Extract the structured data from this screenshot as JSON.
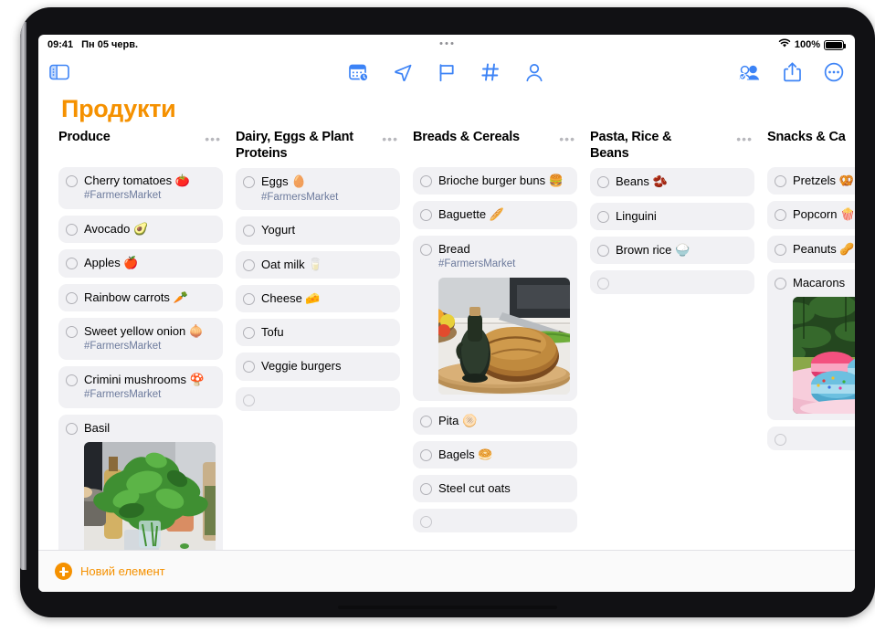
{
  "statusbar": {
    "time": "09:41",
    "date": "Пн 05 черв.",
    "battery_percent": "100%",
    "wifi_icon": "wifi-icon",
    "battery_icon": "battery-icon"
  },
  "toolbar": {
    "sidebar_toggle_icon": "sidebar-toggle-icon",
    "center_icons": [
      {
        "name": "calendar-clock-icon"
      },
      {
        "name": "send-arrow-icon"
      },
      {
        "name": "flag-icon"
      },
      {
        "name": "hashtag-icon"
      },
      {
        "name": "person-icon"
      }
    ],
    "right_icons": [
      {
        "name": "collaborate-icon"
      },
      {
        "name": "share-icon"
      },
      {
        "name": "more-circle-icon"
      }
    ],
    "accent_color": "#3C83F6"
  },
  "page_title": "Продукти",
  "title_color": "#F59100",
  "columns": [
    {
      "title": "Produce",
      "menu": "•••",
      "items": [
        {
          "text": "Cherry tomatoes 🍅",
          "tag": "#FarmersMarket"
        },
        {
          "text": "Avocado 🥑",
          "tag": ""
        },
        {
          "text": "Apples 🍎",
          "tag": ""
        },
        {
          "text": "Rainbow carrots 🥕",
          "tag": ""
        },
        {
          "text": "Sweet yellow onion 🧅",
          "tag": "#FarmersMarket"
        },
        {
          "text": "Crimini mushrooms 🍄",
          "tag": "#FarmersMarket"
        },
        {
          "text": "Basil",
          "tag": "",
          "photo": "basil-plant-photo"
        },
        {
          "text": "",
          "tag": "",
          "empty": true
        }
      ]
    },
    {
      "title": "Dairy, Eggs & Plant\nProteins",
      "menu": "•••",
      "items": [
        {
          "text": "Eggs 🥚",
          "tag": "#FarmersMarket"
        },
        {
          "text": "Yogurt",
          "tag": ""
        },
        {
          "text": "Oat milk 🥛",
          "tag": ""
        },
        {
          "text": "Cheese 🧀",
          "tag": ""
        },
        {
          "text": "Tofu",
          "tag": ""
        },
        {
          "text": "Veggie burgers",
          "tag": ""
        },
        {
          "text": "",
          "tag": "",
          "empty": true
        }
      ]
    },
    {
      "title": "Breads & Cereals",
      "menu": "•••",
      "items": [
        {
          "text": "Brioche burger buns 🍔",
          "tag": ""
        },
        {
          "text": "Baguette 🥖",
          "tag": ""
        },
        {
          "text": "Bread",
          "tag": "#FarmersMarket",
          "photo": "bread-loaf-photo"
        },
        {
          "text": "Pita 🫓",
          "tag": ""
        },
        {
          "text": "Bagels 🥯",
          "tag": ""
        },
        {
          "text": "Steel cut oats",
          "tag": ""
        },
        {
          "text": "",
          "tag": "",
          "empty": true
        }
      ]
    },
    {
      "title": "Pasta, Rice &\nBeans",
      "menu": "•••",
      "items": [
        {
          "text": "Beans 🫘",
          "tag": ""
        },
        {
          "text": "Linguini",
          "tag": ""
        },
        {
          "text": "Brown rice 🍚",
          "tag": ""
        },
        {
          "text": "",
          "tag": "",
          "empty": true
        }
      ]
    },
    {
      "title": "Snacks & Ca",
      "menu": "",
      "items": [
        {
          "text": "Pretzels 🥨",
          "tag": ""
        },
        {
          "text": "Popcorn 🍿",
          "tag": ""
        },
        {
          "text": "Peanuts 🥜",
          "tag": ""
        },
        {
          "text": "Macarons",
          "tag": "",
          "photo": "macarons-photo"
        },
        {
          "text": "",
          "tag": "",
          "empty": true
        }
      ]
    }
  ],
  "bottombar": {
    "new_item_label": "Новий елемент",
    "plus_icon": "plus-circle-icon"
  }
}
